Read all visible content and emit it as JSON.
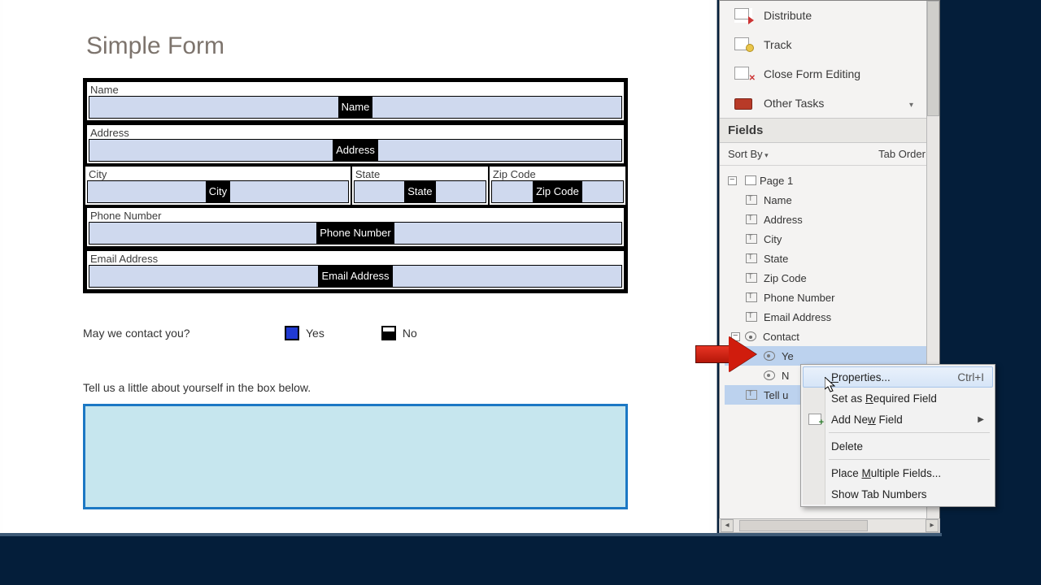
{
  "form": {
    "title": "Simple Form",
    "labels": {
      "name": "Name",
      "address": "Address",
      "city": "City",
      "state": "State",
      "zip": "Zip Code",
      "phone": "Phone Number",
      "email": "Email Address"
    },
    "field_names": {
      "name": "Name",
      "address": "Address",
      "city": "City",
      "state": "State",
      "zip": "Zip Code",
      "phone": "Phone Number",
      "email": "Email Address"
    },
    "contact_question": "May we contact you?",
    "contact_yes": "Yes",
    "contact_no": "No",
    "about_label": "Tell us a little about yourself in the box below."
  },
  "toolbar": {
    "distribute": "Distribute",
    "track": "Track",
    "close_form_editing": "Close Form Editing",
    "other_tasks": "Other Tasks"
  },
  "fields_panel": {
    "header": "Fields",
    "sort_by": "Sort By",
    "tab_order": "Tab Order",
    "page_label": "Page 1",
    "items": [
      "Name",
      "Address",
      "City",
      "State",
      "Zip Code",
      "Phone Number",
      "Email Address"
    ],
    "contact_group": "Contact",
    "contact_children": [
      "Ye",
      "N"
    ],
    "tell_us": "Tell u"
  },
  "context_menu": {
    "properties": "Properties...",
    "properties_shortcut": "Ctrl+I",
    "set_required": "Set as Required Field",
    "add_new_field": "Add New Field",
    "delete": "Delete",
    "place_multiple": "Place Multiple Fields...",
    "show_tab_numbers": "Show Tab Numbers"
  }
}
